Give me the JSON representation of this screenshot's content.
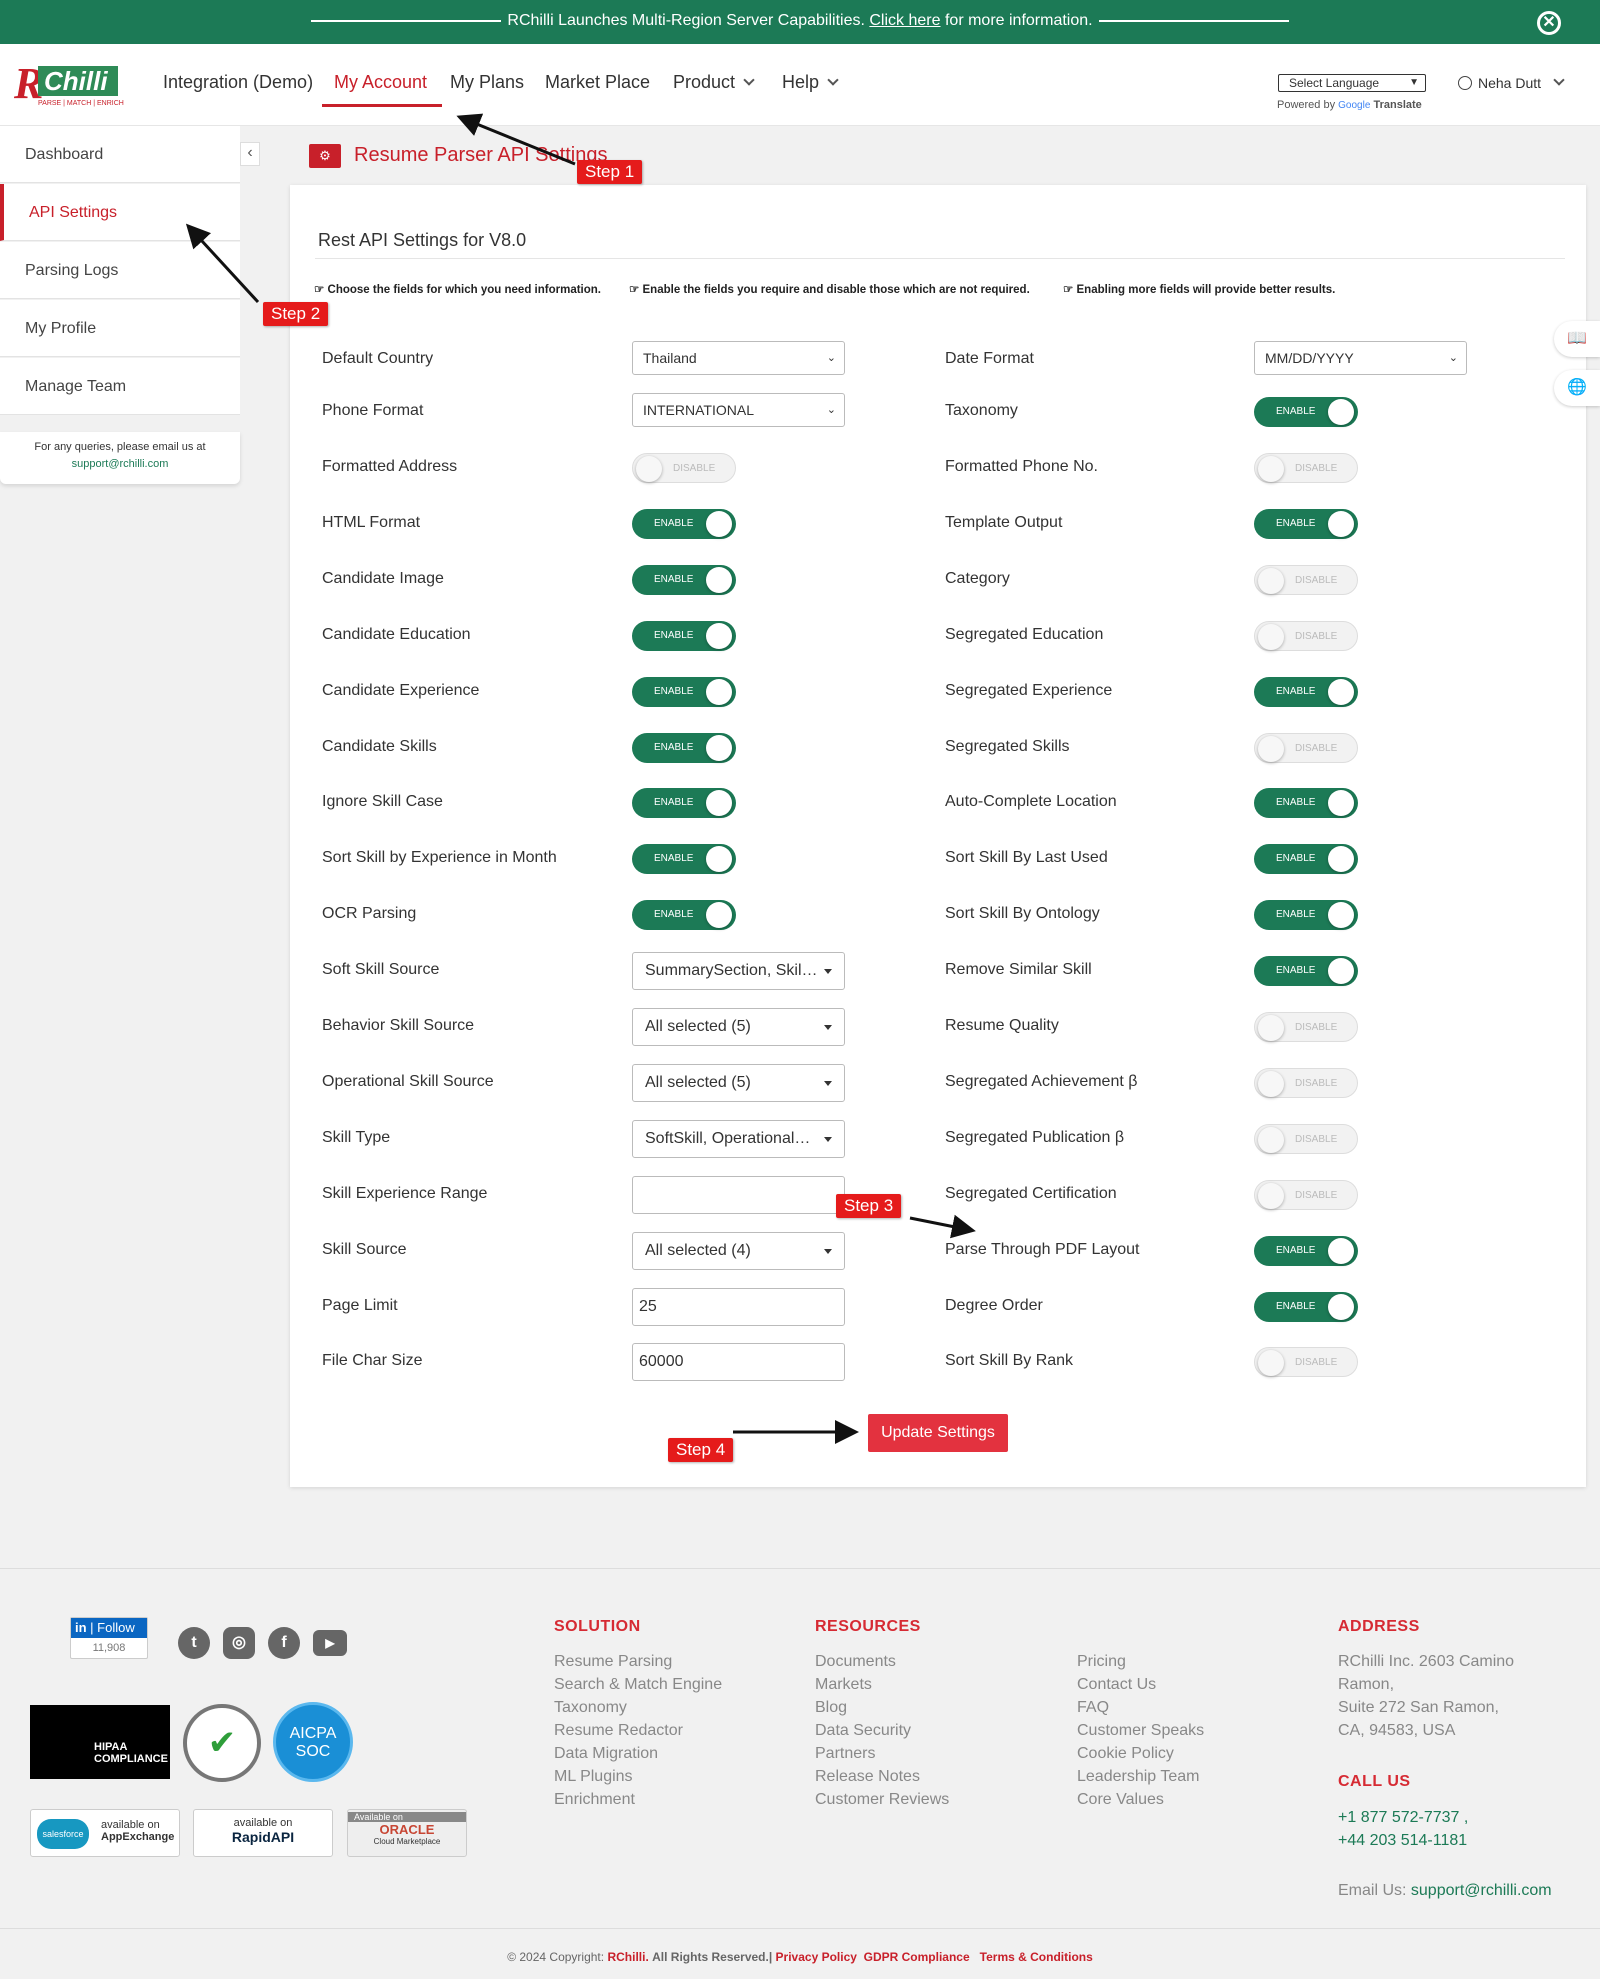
{
  "banner": {
    "text": "RChilli Launches Multi-Region Server Capabilities.",
    "link": "Click here",
    "suffix": "for more information."
  },
  "brand": {
    "logo_text": "Chilli",
    "logo_initial": "R",
    "tagline": "PARSE | MATCH | ENRICH"
  },
  "nav": [
    "Integration (Demo)",
    "My Account",
    "My Plans",
    "Market Place",
    "Product",
    "Help"
  ],
  "language": {
    "selected": "Select Language",
    "powered_by": "Powered by",
    "google": "Google",
    "translate": "Translate"
  },
  "user": {
    "name": "Neha Dutt"
  },
  "sidebar": {
    "items": [
      "Dashboard",
      "API Settings",
      "Parsing Logs",
      "My Profile",
      "Manage Team"
    ],
    "query_text": "For any queries, please email us at",
    "query_email": "support@rchilli.com"
  },
  "page": {
    "title": "Resume Parser API Settings",
    "heading": "Rest API Settings for V8.0"
  },
  "hints": [
    "Choose the fields for which you need information.",
    "Enable the fields you require and disable those which are not required.",
    "Enabling more fields will provide better results."
  ],
  "toggle_labels": {
    "on": "ENABLE",
    "off": "DISABLE"
  },
  "left_rows": [
    {
      "label": "Default Country",
      "type": "select",
      "value": "Thailand"
    },
    {
      "label": "Phone Format",
      "type": "select",
      "value": "INTERNATIONAL"
    },
    {
      "label": "Formatted Address",
      "type": "toggle",
      "on": false
    },
    {
      "label": "HTML Format",
      "type": "toggle",
      "on": true
    },
    {
      "label": "Candidate Image",
      "type": "toggle",
      "on": true
    },
    {
      "label": "Candidate Education",
      "type": "toggle",
      "on": true
    },
    {
      "label": "Candidate Experience",
      "type": "toggle",
      "on": true
    },
    {
      "label": "Candidate Skills",
      "type": "toggle",
      "on": true
    },
    {
      "label": "Ignore Skill Case",
      "type": "toggle",
      "on": true
    },
    {
      "label": "Sort Skill by Experience in Month",
      "type": "toggle",
      "on": true
    },
    {
      "label": "OCR Parsing",
      "type": "toggle",
      "on": true
    },
    {
      "label": "Soft Skill Source",
      "type": "multi",
      "value": "SummarySection, Skil…"
    },
    {
      "label": "Behavior Skill Source",
      "type": "multi",
      "value": "All selected (5)"
    },
    {
      "label": "Operational Skill Source",
      "type": "multi",
      "value": "All selected (5)"
    },
    {
      "label": "Skill Type",
      "type": "multi",
      "value": "SoftSkill, Operational…"
    },
    {
      "label": "Skill Experience Range",
      "type": "text",
      "value": ""
    },
    {
      "label": "Skill Source",
      "type": "multi",
      "value": "All selected (4)"
    },
    {
      "label": "Page Limit",
      "type": "text",
      "value": "25"
    },
    {
      "label": "File Char Size",
      "type": "text",
      "value": "60000"
    }
  ],
  "right_rows": [
    {
      "label": "Date Format",
      "type": "select",
      "value": "MM/DD/YYYY"
    },
    {
      "label": "Taxonomy",
      "type": "toggle",
      "on": true
    },
    {
      "label": "Formatted Phone No.",
      "type": "toggle",
      "on": false
    },
    {
      "label": "Template Output",
      "type": "toggle",
      "on": true
    },
    {
      "label": "Category",
      "type": "toggle",
      "on": false
    },
    {
      "label": "Segregated Education",
      "type": "toggle",
      "on": false
    },
    {
      "label": "Segregated Experience",
      "type": "toggle",
      "on": true
    },
    {
      "label": "Segregated Skills",
      "type": "toggle",
      "on": false
    },
    {
      "label": "Auto-Complete Location",
      "type": "toggle",
      "on": true
    },
    {
      "label": "Sort Skill By Last Used",
      "type": "toggle",
      "on": true
    },
    {
      "label": "Sort Skill By Ontology",
      "type": "toggle",
      "on": true
    },
    {
      "label": "Remove Similar Skill",
      "type": "toggle",
      "on": true
    },
    {
      "label": "Resume Quality",
      "type": "toggle",
      "on": false
    },
    {
      "label": "Segregated Achievement β",
      "type": "toggle",
      "on": false
    },
    {
      "label": "Segregated Publication β",
      "type": "toggle",
      "on": false
    },
    {
      "label": "Segregated Certification",
      "type": "toggle",
      "on": false
    },
    {
      "label": "Parse Through PDF Layout",
      "type": "toggle",
      "on": true
    },
    {
      "label": "Degree Order",
      "type": "toggle",
      "on": true
    },
    {
      "label": "Sort Skill By Rank",
      "type": "toggle",
      "on": false
    }
  ],
  "update_button": "Update Settings",
  "steps": [
    "Step 1",
    "Step 2",
    "Step 3",
    "Step 4"
  ],
  "footer": {
    "linkedin_follow": "Follow",
    "linkedin_in": "in",
    "linkedin_count": "11,908",
    "badges": {
      "hipaa": "HIPAA COMPLIANCE",
      "aicpa": "AICPA",
      "soc": "SOC",
      "appexchange_pre": "available on",
      "appexchange": "AppExchange",
      "salesforce": "salesforce",
      "rapid_pre": "available on",
      "rapid": "RapidAPI",
      "oracle_pre": "Available on",
      "oracle": "ORACLE",
      "oracle_sub": "Cloud Marketplace"
    },
    "solution_title": "SOLUTION",
    "solution": [
      "Resume Parsing",
      "Search & Match Engine",
      "Taxonomy",
      "Resume Redactor",
      "Data Migration",
      "ML Plugins",
      "Enrichment"
    ],
    "resources_title": "RESOURCES",
    "resources": [
      "Documents",
      "Markets",
      "Blog",
      "Data Security",
      "Partners",
      "Release Notes",
      "Customer Reviews"
    ],
    "resources2": [
      "Pricing",
      "Contact Us",
      "FAQ",
      "Customer Speaks",
      "Cookie Policy",
      "Leadership Team",
      "Core Values"
    ],
    "address_title": "ADDRESS",
    "address": [
      "RChilli Inc. 2603 Camino",
      "Ramon,",
      "Suite 272 San Ramon,",
      "CA, 94583, USA"
    ],
    "call_title": "CALL US",
    "phones": [
      "+1 877 572-7737 ,",
      "+44 203 514-1181"
    ],
    "email_label": "Email Us:",
    "email": "support@rchilli.com",
    "copyright": "© 2024 Copyright:",
    "copyright_brand": "RChilli.",
    "copyright_rest": "All Rights Reserved.|",
    "privacy": "Privacy Policy",
    "gdpr": "GDPR Compliance",
    "terms": "Terms & Conditions"
  }
}
